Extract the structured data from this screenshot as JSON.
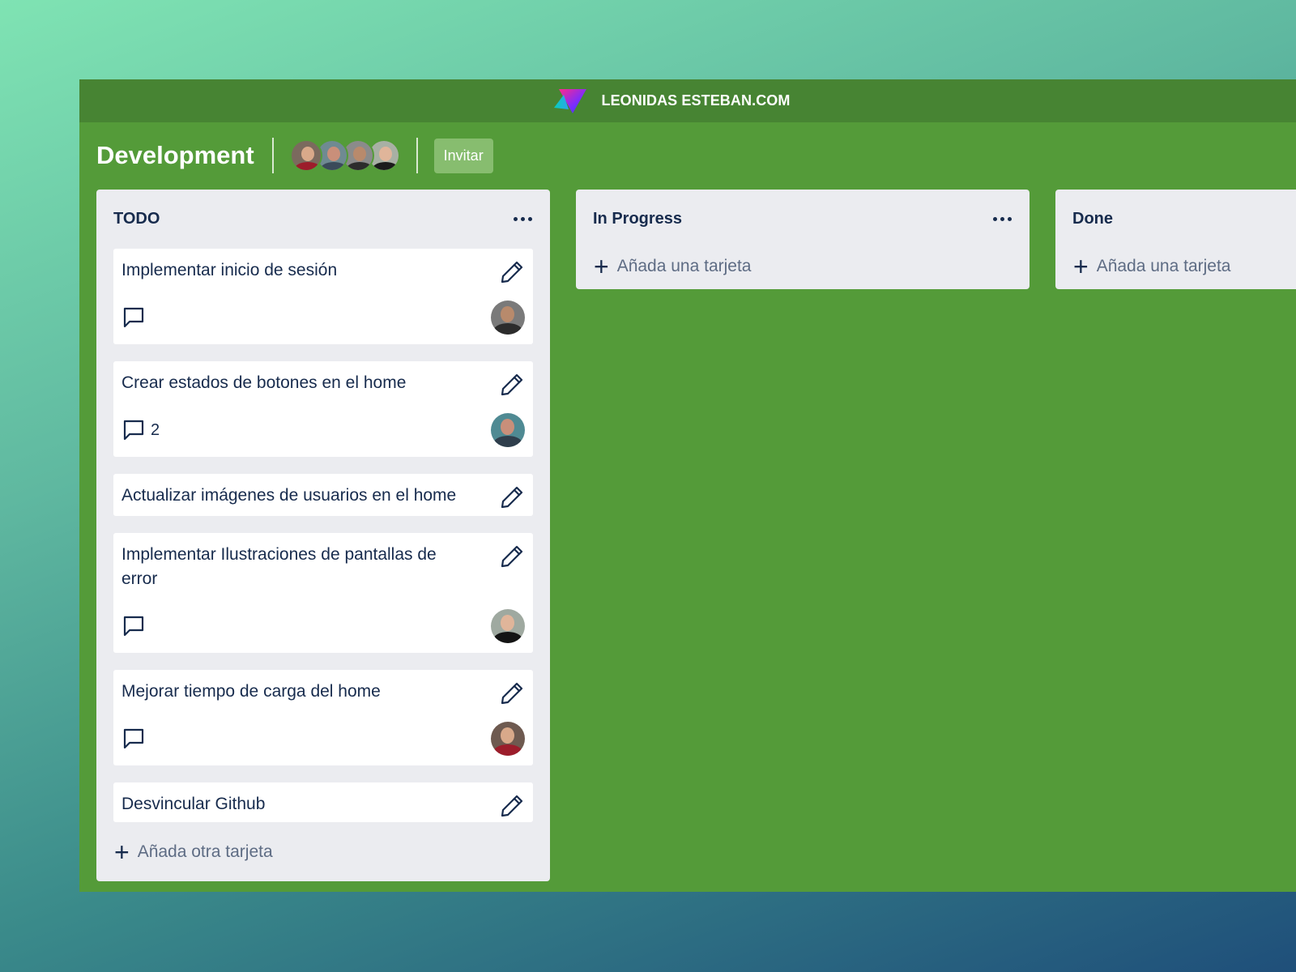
{
  "topbar": {
    "brand_name": "LEONIDAS ESTEBAN.COM",
    "logo_icon": "triangle-gradient-logo"
  },
  "board": {
    "title": "Development",
    "invite_label": "Invitar",
    "members": [
      {
        "name": "member-1",
        "face": "#d9a98a",
        "body": "#9c1d2b",
        "bg": "#7b6a5e"
      },
      {
        "name": "member-2",
        "face": "#c98f7a",
        "body": "#3b4a5a",
        "bg": "#6f8a92"
      },
      {
        "name": "member-3",
        "face": "#b88a6c",
        "body": "#2c2c2c",
        "bg": "#8b8b8b"
      },
      {
        "name": "member-4",
        "face": "#e0b59a",
        "body": "#1b1b1b",
        "bg": "#a8b0a4"
      }
    ]
  },
  "lists": [
    {
      "title": "TODO",
      "add_label": "Añada otra tarjeta",
      "cards": [
        {
          "title": "Implementar inicio de sesión",
          "comments": "",
          "avatar": {
            "face": "#b88a6c",
            "body": "#2c2c2c",
            "bg": "#7a7a7a"
          }
        },
        {
          "title": "Crear estados de botones en el home",
          "comments": "2",
          "avatar": {
            "face": "#c98f7a",
            "body": "#2f3e4c",
            "bg": "#4f8a93"
          }
        },
        {
          "title": "Actualizar imágenes de usuarios en el home"
        },
        {
          "title": "Implementar Ilustraciones de pantallas de error",
          "comments": "",
          "avatar": {
            "face": "#e0b59a",
            "body": "#141414",
            "bg": "#9fa9a0"
          }
        },
        {
          "title": "Mejorar tiempo de carga del home",
          "comments": "",
          "avatar": {
            "face": "#d9a98a",
            "body": "#9c1d2b",
            "bg": "#6e5a50"
          }
        },
        {
          "title": "Desvincular Github"
        }
      ]
    },
    {
      "title": "In Progress",
      "add_label": "Añada una tarjeta"
    },
    {
      "title": "Done",
      "add_label": "Añada una tarjeta"
    }
  ],
  "colors": {
    "board_bg": "#549b39",
    "topbar_bg": "#478433",
    "list_bg": "#ebecf0",
    "invite_bg": "#87bd6f"
  }
}
